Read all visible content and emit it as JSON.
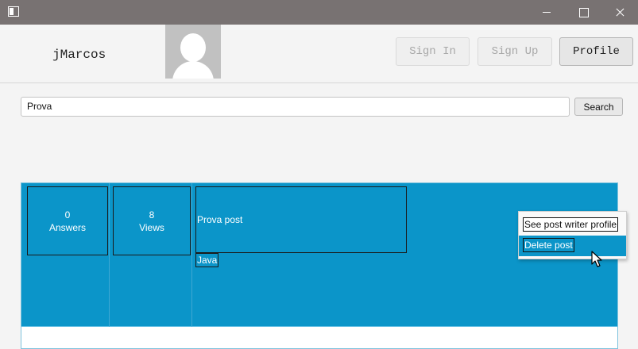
{
  "header": {
    "username": "jMarcos",
    "sign_in_label": "Sign In",
    "sign_up_label": "Sign Up",
    "profile_label": "Profile"
  },
  "search": {
    "value": "Prova",
    "button_label": "Search"
  },
  "posts": [
    {
      "answers_count": "0",
      "answers_label": "Answers",
      "views_count": "8",
      "views_label": "Views",
      "title": "Prova post",
      "tags": [
        "Java"
      ]
    }
  ],
  "context_menu": {
    "items": [
      {
        "label": "See post writer profile"
      },
      {
        "label": "Delete post"
      }
    ]
  },
  "colors": {
    "titlebar": "#787272",
    "post_selected": "#0b95c9"
  }
}
